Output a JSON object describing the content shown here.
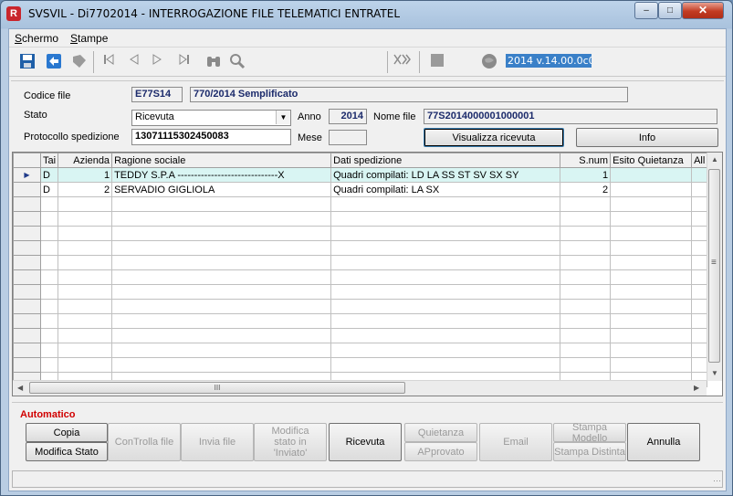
{
  "window": {
    "app_icon": "R",
    "title": "SVSVIL - Di7702014 - INTERROGAZIONE FILE TELEMATICI ENTRATEL",
    "minimize_glyph": "–",
    "maximize_glyph": "□",
    "close_glyph": "✕"
  },
  "menu": {
    "items": [
      {
        "accel": "S",
        "rest": "chermo"
      },
      {
        "accel": "S",
        "rest": "tampe"
      }
    ]
  },
  "toolbar": {
    "icons": [
      "save-icon",
      "back-icon",
      "tag-icon",
      "first-icon",
      "prev-icon",
      "next-icon",
      "last-icon",
      "binoculars-icon",
      "search-icon",
      "cut-icon",
      "stop-icon",
      "globe-icon"
    ],
    "version": "2014 v.14.00.0c00"
  },
  "form": {
    "codice_file_label": "Codice file",
    "codice_file": "E77S14",
    "descrizione": "770/2014 Semplificato",
    "stato_label": "Stato",
    "stato_value": "Ricevuta",
    "anno_label": "Anno",
    "anno": "2014",
    "nome_file_label": "Nome file",
    "nome_file": "77S2014000001000001",
    "protocollo_label": "Protocollo spedizione",
    "protocollo": "13071115302450083",
    "mese_label": "Mese",
    "mese": "",
    "visualizza_button": "Visualizza ricevuta",
    "info_button": "Info"
  },
  "grid": {
    "columns": [
      "Tai",
      "Azienda",
      "Ragione sociale",
      "Dati spedizione",
      "S.num",
      "Esito Quietanza",
      "All"
    ],
    "rows": [
      {
        "tipo": "D",
        "azienda": "1",
        "ragione": "TEDDY S.P.A ------------------------------X",
        "dati": "Quadri compilati: LD LA SS ST SV SX SY",
        "snum": "1",
        "esito": "",
        "all": "",
        "selected": true
      },
      {
        "tipo": "D",
        "azienda": "2",
        "ragione": "SERVADIO GIGLIOLA",
        "dati": "Quadri compilati: LA SX",
        "snum": "2",
        "esito": "",
        "all": "",
        "selected": false
      }
    ],
    "empty_rows": 13,
    "scrollbar_grip_glyph": "III",
    "vscroll_grip_glyph": "≡"
  },
  "actions": {
    "automatico_label": "Automatico",
    "copia": "Copia",
    "modifica_stato": "Modifica Stato",
    "controlla_file": "ConTrolla file",
    "invia_file": "Invia file",
    "modifica_inviato": "Modifica stato in 'Inviato'",
    "ricevuta": "Ricevuta",
    "quietanza": "Quietanza",
    "approvato": "APprovato",
    "email": "Email",
    "stampa_modello": "Stampa Modello",
    "stampa_distinta": "Stampa Distinta",
    "annulla": "Annulla"
  }
}
